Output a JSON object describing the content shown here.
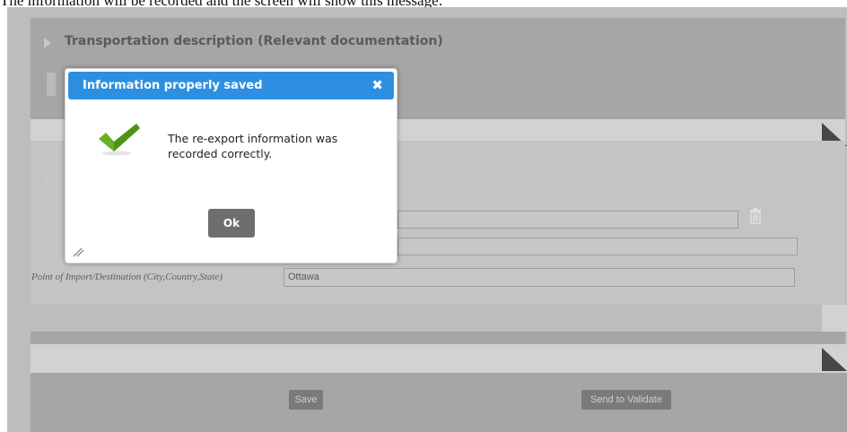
{
  "top_text": "The information will be recorded and the screen will show this message:",
  "background": {
    "section1_title": "Transportation description (Relevant documentation)",
    "point_of_import_label": "Point of Import/Destination (City,Country,State)",
    "point_of_import_value": "Ottawa",
    "save_label": "Save",
    "send_label": "Send to Validate"
  },
  "dialog": {
    "title": "Information properly saved",
    "close_symbol": "✖",
    "message": "The re-export information was recorded correctly.",
    "ok_label": "Ok"
  },
  "colors": {
    "dialog_header": "#2e8fe0",
    "check_green": "#6ab023",
    "ok_button": "#6e6e6e"
  },
  "icons": [
    "check-icon",
    "close-icon",
    "trash-icon",
    "resize-grip-icon",
    "expand-arrow-icon",
    "corner-triangle-icon"
  ]
}
